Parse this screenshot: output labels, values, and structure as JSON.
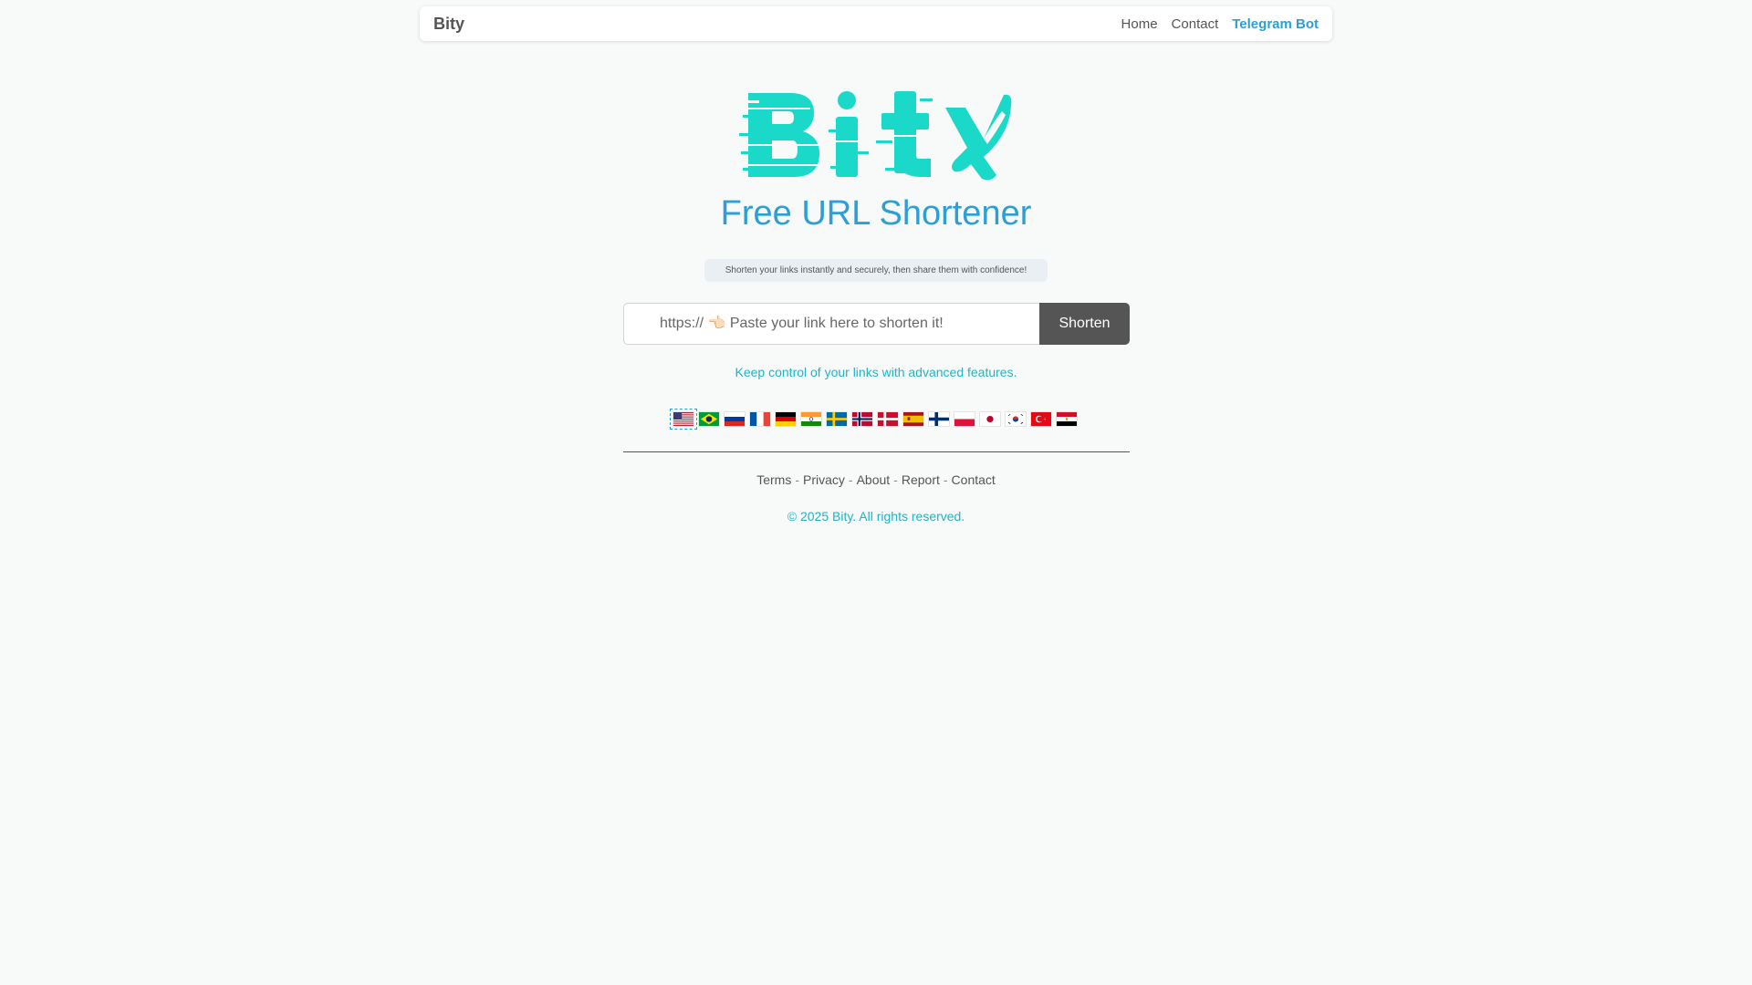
{
  "navbar": {
    "brand": "Bity",
    "links": [
      {
        "label": "Home"
      },
      {
        "label": "Contact"
      },
      {
        "label": "Telegram Bot"
      }
    ]
  },
  "hero": {
    "logo_text": "Bity",
    "title": "Free URL Shortener",
    "tagline": "Shorten your links instantly and securely, then share them with confidence!"
  },
  "form": {
    "placeholder": "https:// 👈🏻 Paste your link here to shorten it!",
    "value": "",
    "button_label": "Shorten"
  },
  "feature_text": "Keep control of your links with advanced features.",
  "languages": {
    "selected": "en",
    "flags": [
      {
        "code": "en",
        "icon": "us-flag-icon"
      },
      {
        "code": "pt",
        "icon": "brazil-flag-icon"
      },
      {
        "code": "ru",
        "icon": "russia-flag-icon"
      },
      {
        "code": "fr",
        "icon": "france-flag-icon"
      },
      {
        "code": "de",
        "icon": "germany-flag-icon"
      },
      {
        "code": "hi",
        "icon": "india-flag-icon"
      },
      {
        "code": "sv",
        "icon": "sweden-flag-icon"
      },
      {
        "code": "no",
        "icon": "norway-flag-icon"
      },
      {
        "code": "da",
        "icon": "denmark-flag-icon"
      },
      {
        "code": "es",
        "icon": "spain-flag-icon"
      },
      {
        "code": "fi",
        "icon": "finland-flag-icon"
      },
      {
        "code": "pl",
        "icon": "poland-flag-icon"
      },
      {
        "code": "ja",
        "icon": "japan-flag-icon"
      },
      {
        "code": "ko",
        "icon": "korea-flag-icon"
      },
      {
        "code": "tr",
        "icon": "turkey-flag-icon"
      },
      {
        "code": "ar",
        "icon": "egypt-flag-icon"
      }
    ]
  },
  "footer": {
    "links": [
      {
        "label": "Terms"
      },
      {
        "label": "Privacy"
      },
      {
        "label": "About"
      },
      {
        "label": "Report"
      },
      {
        "label": "Contact"
      }
    ],
    "separator": "-",
    "copyright": "© 2025 Bity. All rights reserved."
  },
  "colors": {
    "accent": "#2c9fd6",
    "logo": "#1ad9c8",
    "teal_text": "#1fb5c4",
    "button": "#555555"
  }
}
